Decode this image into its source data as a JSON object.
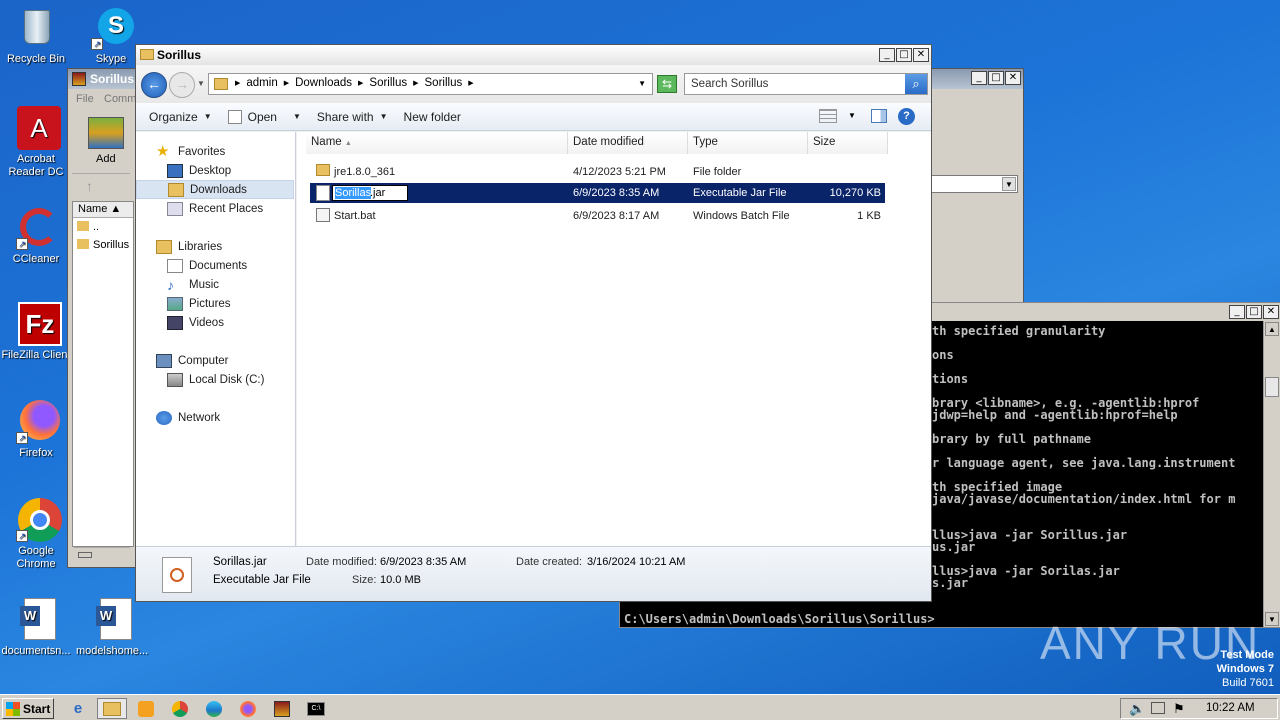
{
  "desktop_icons": [
    {
      "label": "Recycle Bin",
      "icon": "recycle-bin-icon"
    },
    {
      "label": "Skype",
      "icon": "skype-icon"
    },
    {
      "label": "Acrobat Reader DC",
      "icon": "acrobat-icon"
    },
    {
      "label": "CCleaner",
      "icon": "ccleaner-icon"
    },
    {
      "label": "FileZilla Client",
      "icon": "filezilla-icon"
    },
    {
      "label": "Firefox",
      "icon": "firefox-icon"
    },
    {
      "label": "Google Chrome",
      "icon": "chrome-icon"
    },
    {
      "label": "documentsn...",
      "icon": "word-doc-icon"
    },
    {
      "label": "modelshome...",
      "icon": "word-doc-icon"
    }
  ],
  "winrar": {
    "title": "Sorillus.",
    "menu_file": "File",
    "menu_commands": "Comm",
    "add_label": "Add",
    "col_name": "Name",
    "rows": [
      "..",
      "Sorillus"
    ]
  },
  "explorer": {
    "title": "Sorillus",
    "breadcrumb": [
      "admin",
      "Downloads",
      "Sorillus",
      "Sorillus"
    ],
    "search_placeholder": "Search Sorillus",
    "toolbar": {
      "organize": "Organize",
      "open": "Open",
      "share_with": "Share with",
      "new_folder": "New folder"
    },
    "nav": {
      "favorites": "Favorites",
      "desktop": "Desktop",
      "downloads": "Downloads",
      "recent": "Recent Places",
      "libraries": "Libraries",
      "documents": "Documents",
      "music": "Music",
      "pictures": "Pictures",
      "videos": "Videos",
      "computer": "Computer",
      "local_disk": "Local Disk (C:)",
      "network": "Network"
    },
    "columns": {
      "name": "Name",
      "date": "Date modified",
      "type": "Type",
      "size": "Size"
    },
    "files": [
      {
        "name": "jre1.8.0_361",
        "date": "4/12/2023 5:21 PM",
        "type": "File folder",
        "size": ""
      },
      {
        "name": "Sorillas.jar",
        "date": "6/9/2023 8:35 AM",
        "type": "Executable Jar File",
        "size": "10,270 KB"
      },
      {
        "name": "Start.bat",
        "date": "6/9/2023 8:17 AM",
        "type": "Windows Batch File",
        "size": "1 KB"
      }
    ],
    "rename_value": "Sorillas",
    "rename_ext": ".jar",
    "details": {
      "name": "Sorillas.jar",
      "type": "Executable Jar File",
      "modified_label": "Date modified:",
      "modified": "6/9/2023 8:35 AM",
      "size_label": "Size:",
      "size": "10.0 MB",
      "created_label": "Date created:",
      "created": "3/16/2024 10:21 AM"
    }
  },
  "console": {
    "lines": [
      "th specified granularity",
      "",
      "ons",
      "",
      "tions",
      "",
      "brary <libname>, e.g. -agentlib:hprof",
      "jdwp=help and -agentlib:hprof=help",
      "",
      "brary by full pathname",
      "",
      "r language agent, see java.lang.instrument",
      "",
      "th specified image",
      "java/javase/documentation/index.html for m",
      "",
      "",
      "llus>java -jar Sorillus.jar",
      "us.jar",
      "",
      "llus>java -jar Sorilas.jar",
      "s.jar"
    ],
    "prompt": "C:\\Users\\admin\\Downloads\\Sorillus\\Sorillus>"
  },
  "watermark": "ANY RUN",
  "test_mode": {
    "line1": "Test Mode",
    "line2": "Windows 7",
    "line3": "Build 7601"
  },
  "taskbar": {
    "start": "Start",
    "clock": "10:22 AM"
  }
}
